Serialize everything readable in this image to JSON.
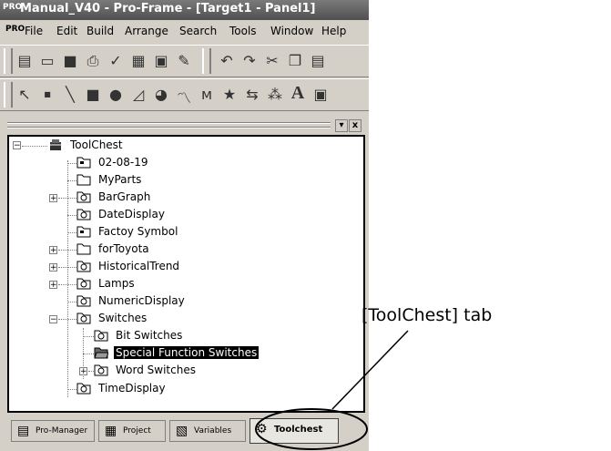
{
  "window": {
    "title": "Manual_V40 - Pro-Frame - [Target1 - Panel1]",
    "app_logo": "PRO"
  },
  "menu": [
    "File",
    "Edit",
    "Build",
    "Arrange",
    "Search",
    "Tools",
    "Window",
    "Help"
  ],
  "toolbar1_icons": [
    "new-icon",
    "open-icon",
    "save-icon",
    "print-icon",
    "check-icon",
    "grid-icon",
    "copy-file-icon",
    "pencil-icon",
    "undo-icon",
    "redo-icon",
    "cut-icon",
    "copy-icon",
    "paste-icon"
  ],
  "toolbar2_icons": [
    "pointer-icon",
    "dot-icon",
    "line-icon",
    "rectangle-icon",
    "circle-icon",
    "polygon-icon",
    "pie-icon",
    "polyline-icon",
    "freehand-icon",
    "star-icon",
    "connector-icon",
    "pattern-icon",
    "text-icon",
    "image-icon"
  ],
  "panel_buttons": {
    "dock": "▾",
    "close": "x"
  },
  "tree": {
    "root": "ToolChest",
    "items": [
      {
        "label": "02-08-19",
        "icon": "special-folder",
        "expandable": false
      },
      {
        "label": "MyParts",
        "icon": "folder",
        "expandable": false
      },
      {
        "label": "BarGraph",
        "icon": "part-folder",
        "expandable": true,
        "expanded": false
      },
      {
        "label": "DateDisplay",
        "icon": "part-folder",
        "expandable": false
      },
      {
        "label": "Factoy Symbol",
        "icon": "special-folder",
        "expandable": false
      },
      {
        "label": "forToyota",
        "icon": "folder",
        "expandable": true,
        "expanded": false
      },
      {
        "label": "HistoricalTrend",
        "icon": "part-folder",
        "expandable": true,
        "expanded": false
      },
      {
        "label": "Lamps",
        "icon": "part-folder",
        "expandable": true,
        "expanded": false
      },
      {
        "label": "NumericDisplay",
        "icon": "part-folder",
        "expandable": false
      },
      {
        "label": "Switches",
        "icon": "part-folder",
        "expandable": true,
        "expanded": true,
        "children": [
          {
            "label": "Bit Switches",
            "selected": false
          },
          {
            "label": "Special Function Switches",
            "selected": true
          },
          {
            "label": "Word Switches",
            "expandable": true,
            "selected": false
          }
        ]
      },
      {
        "label": "TimeDisplay",
        "icon": "part-folder",
        "expandable": false
      }
    ]
  },
  "tabs": [
    {
      "label": "Pro-Manager",
      "icon": "manager-icon"
    },
    {
      "label": "Project",
      "icon": "project-icon"
    },
    {
      "label": "Variables",
      "icon": "variables-icon"
    },
    {
      "label": "Toolchest",
      "icon": "toolchest-icon",
      "active": true
    }
  ],
  "callout": "[ToolChest] tab"
}
